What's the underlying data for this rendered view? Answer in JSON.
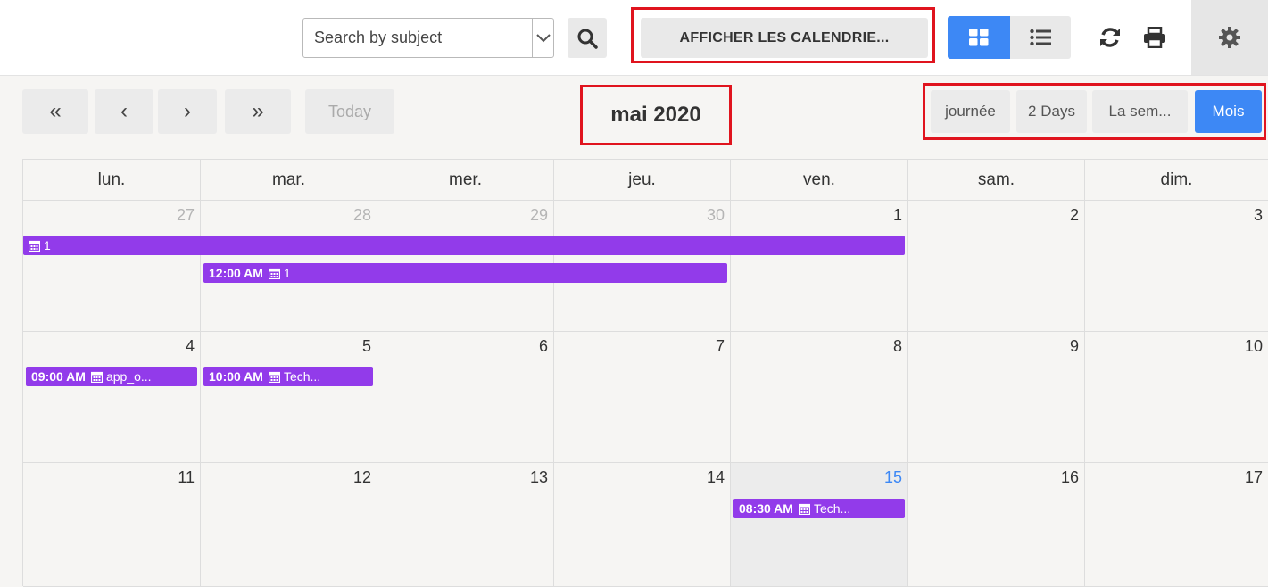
{
  "toolbar": {
    "search_placeholder": "Search by subject",
    "calendars_button": "AFFICHER LES CALENDRIE...",
    "icons": [
      "search-icon",
      "chevron-down-icon",
      "grid-view-icon",
      "list-view-icon",
      "refresh-icon",
      "print-icon",
      "gear-icon"
    ]
  },
  "nav": {
    "first": "«",
    "prev": "‹",
    "next": "›",
    "last": "»",
    "today": "Today",
    "title": "mai 2020"
  },
  "views": [
    {
      "label": "journée",
      "active": false
    },
    {
      "label": "2 Days",
      "active": false
    },
    {
      "label": "La sem...",
      "active": false
    },
    {
      "label": "Mois",
      "active": true
    }
  ],
  "weekdays": [
    "lun.",
    "mar.",
    "mer.",
    "jeu.",
    "ven.",
    "sam.",
    "dim."
  ],
  "weeks": [
    [
      {
        "n": "27",
        "other": true
      },
      {
        "n": "28",
        "other": true
      },
      {
        "n": "29",
        "other": true
      },
      {
        "n": "30",
        "other": true
      },
      {
        "n": "1"
      },
      {
        "n": "2"
      },
      {
        "n": "3"
      }
    ],
    [
      {
        "n": "4"
      },
      {
        "n": "5"
      },
      {
        "n": "6"
      },
      {
        "n": "7"
      },
      {
        "n": "8"
      },
      {
        "n": "9"
      },
      {
        "n": "10"
      }
    ],
    [
      {
        "n": "11"
      },
      {
        "n": "12"
      },
      {
        "n": "13"
      },
      {
        "n": "14"
      },
      {
        "n": "15",
        "today": true
      },
      {
        "n": "16"
      },
      {
        "n": "17"
      }
    ]
  ],
  "events": [
    {
      "time": "",
      "label": "1"
    },
    {
      "time": "12:00 AM",
      "label": "1"
    },
    {
      "time": "09:00 AM",
      "label": "app_o..."
    },
    {
      "time": "10:00 AM",
      "label": "Tech..."
    },
    {
      "time": "08:30 AM",
      "label": "Tech..."
    }
  ],
  "colors": {
    "accent": "#3d88f5",
    "event": "#923bea",
    "highlight": "#e0141e"
  }
}
